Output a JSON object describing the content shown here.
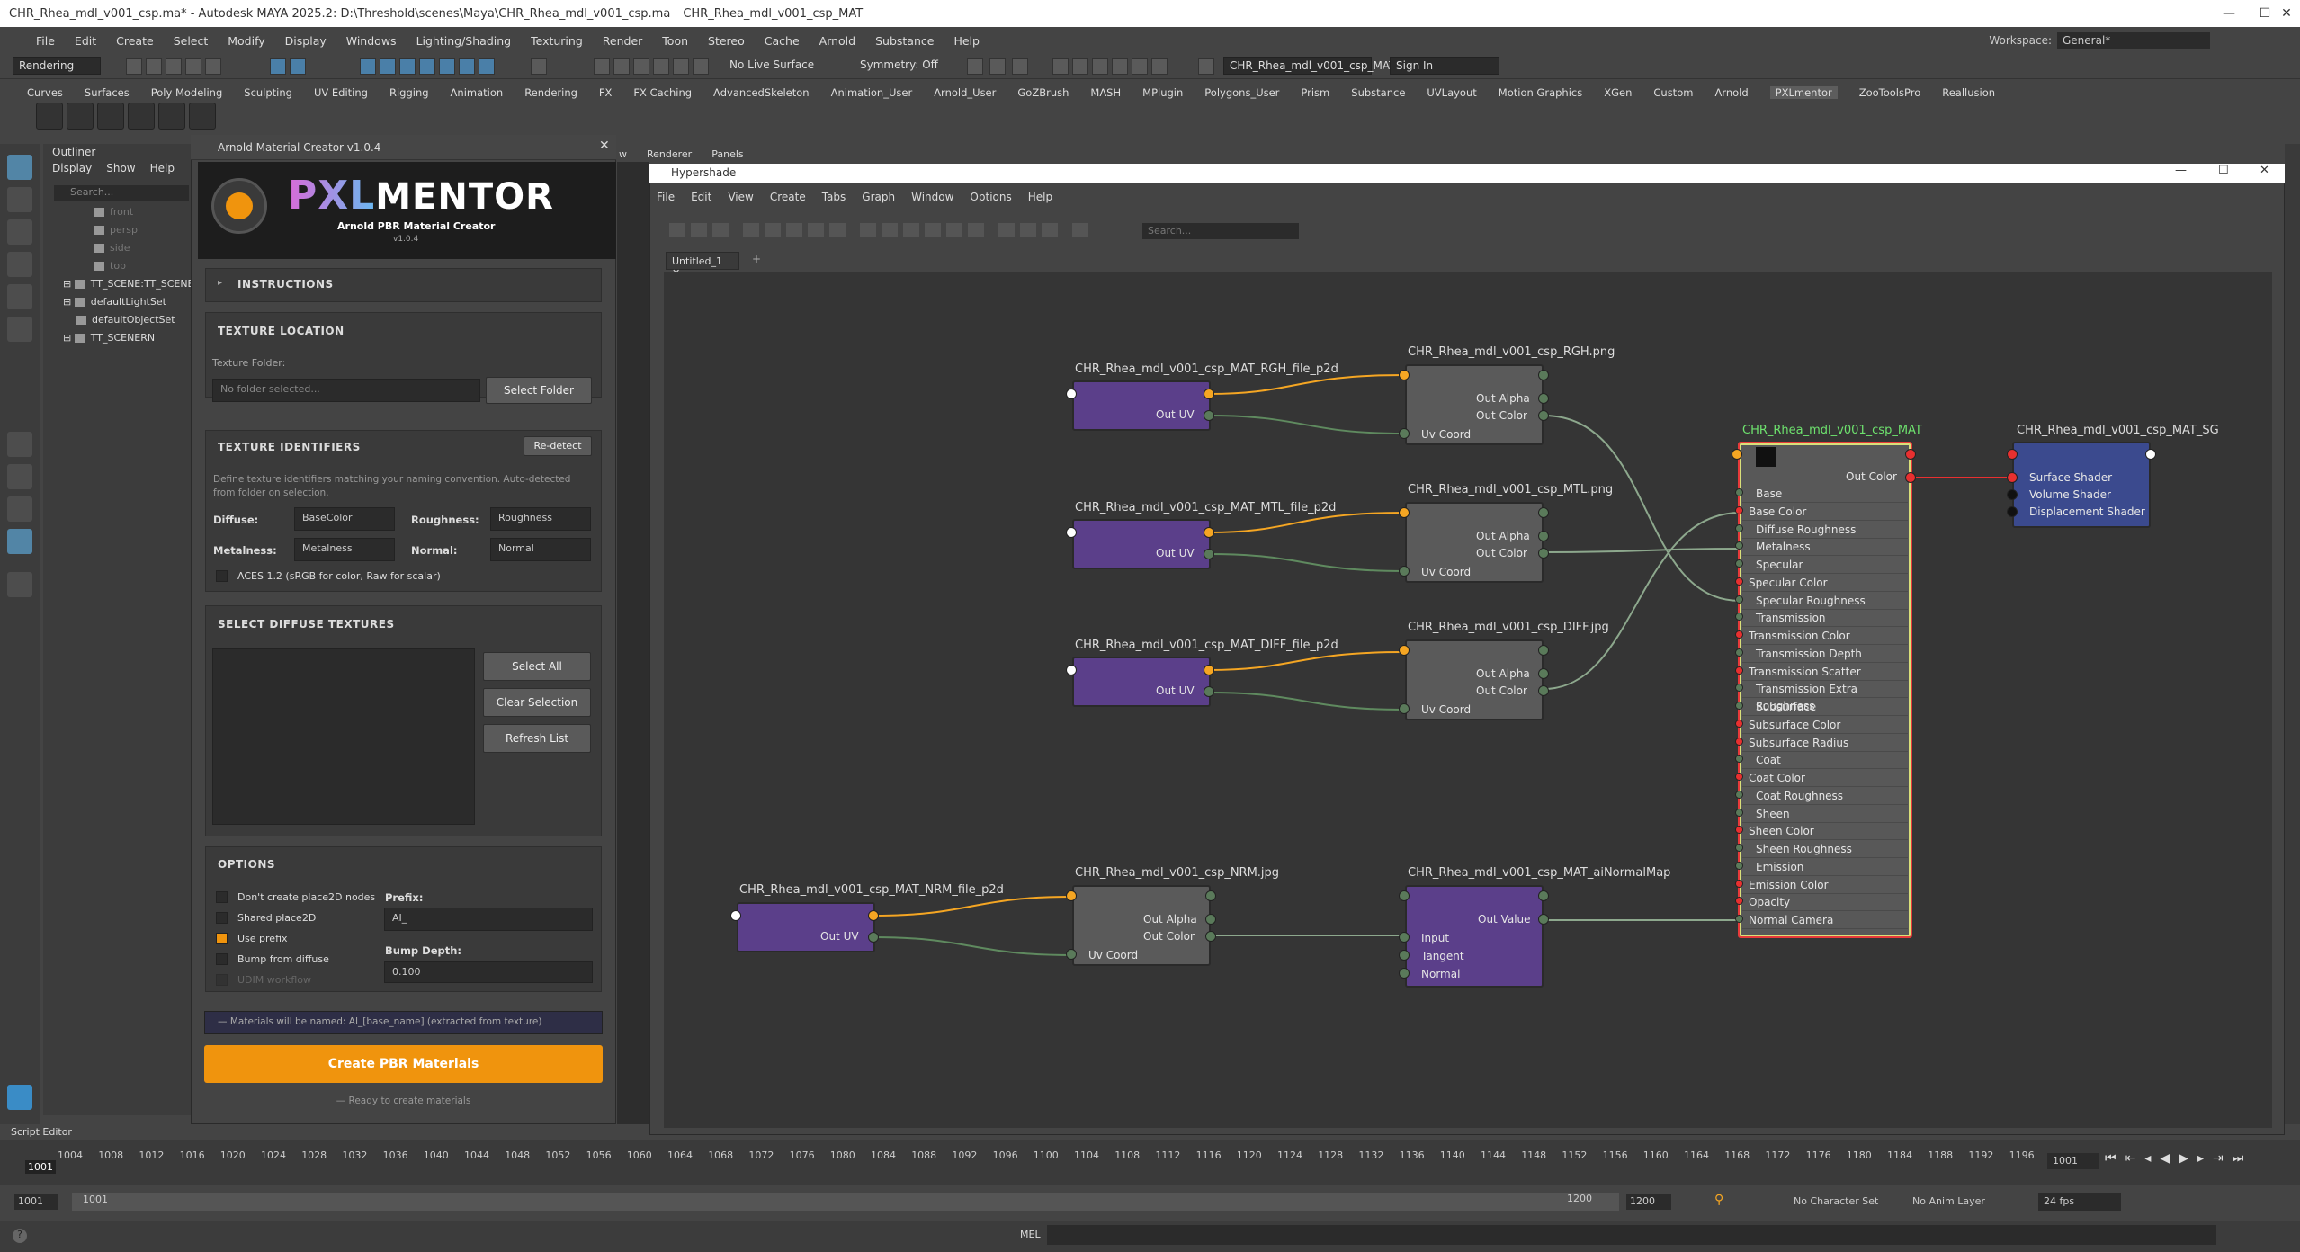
{
  "window": {
    "title": "CHR_Rhea_mdl_v001_csp.ma* - Autodesk MAYA 2025.2: D:\\Threshold\\scenes\\Maya\\CHR_Rhea_mdl_v001_csp.ma",
    "title_extra": "CHR_Rhea_mdl_v001_csp_MAT"
  },
  "menubar": [
    "File",
    "Edit",
    "Create",
    "Select",
    "Modify",
    "Display",
    "Windows",
    "Lighting/Shading",
    "Texturing",
    "Render",
    "Toon",
    "Stereo",
    "Cache",
    "Arnold",
    "Substance",
    "Help"
  ],
  "workspace": {
    "label": "Workspace:",
    "value": "General*"
  },
  "status": {
    "mode": "Rendering",
    "live_surface": "No Live Surface",
    "symmetry": "Symmetry: Off",
    "object_name": "CHR_Rhea_mdl_v001_csp_MAT",
    "sign_in": "Sign In"
  },
  "shelf_tabs": [
    "Curves",
    "Surfaces",
    "Poly Modeling",
    "Sculpting",
    "UV Editing",
    "Rigging",
    "Animation",
    "Rendering",
    "FX",
    "FX Caching",
    "AdvancedSkeleton",
    "Animation_User",
    "Arnold_User",
    "GoZBrush",
    "MASH",
    "MPlugin",
    "Polygons_User",
    "Prism",
    "Substance",
    "UVLayout",
    "Motion Graphics",
    "XGen",
    "Custom",
    "Arnold",
    "PXLmentor",
    "ZooToolsPro",
    "Reallusion"
  ],
  "outliner": {
    "title": "Outliner",
    "menu": [
      "Display",
      "Show",
      "Help"
    ],
    "search": "Search...",
    "cameras": [
      "front",
      "persp",
      "side",
      "top"
    ],
    "items": [
      "TT_SCENE:TT_SCENE_",
      "defaultLightSet",
      "defaultObjectSet",
      "TT_SCENERN"
    ]
  },
  "panel_menu": [
    "w",
    "Renderer",
    "Panels"
  ],
  "amc": {
    "title": "Arnold Material Creator v1.0.4",
    "brand_a": "PXL",
    "brand_b": "MENTOR",
    "subtitle": "Arnold PBR Material Creator",
    "version": "v1.0.4",
    "instructions": "INSTRUCTIONS",
    "texture_location": "TEXTURE LOCATION",
    "texture_folder_label": "Texture Folder:",
    "texture_folder_placeholder": "No folder selected...",
    "select_folder": "Select Folder",
    "identifiers_title": "TEXTURE IDENTIFIERS",
    "redetect": "Re-detect",
    "identifiers_help": "Define texture identifiers matching your naming convention. Auto-detected from folder on selection.",
    "diffuse_label": "Diffuse:",
    "diffuse_value": "BaseColor",
    "roughness_label": "Roughness:",
    "roughness_value": "Roughness",
    "metalness_label": "Metalness:",
    "metalness_value": "Metalness",
    "normal_label": "Normal:",
    "normal_value": "Normal",
    "aces_label": "ACES 1.2 (sRGB for color, Raw for scalar)",
    "diffuse_title": "SELECT DIFFUSE TEXTURES",
    "select_all": "Select All",
    "clear_selection": "Clear Selection",
    "refresh_list": "Refresh List",
    "options_title": "OPTIONS",
    "opt_no_place2d": "Don't create place2D nodes",
    "opt_shared": "Shared place2D",
    "opt_prefix": "Use prefix",
    "opt_bump": "Bump from diffuse",
    "opt_udim": "UDIM workflow",
    "prefix_label": "Prefix:",
    "prefix_value": "AI_",
    "bump_label": "Bump Depth:",
    "bump_value": "0.100",
    "naming_note": "— Materials will be named: AI_[base_name] (extracted from texture)",
    "create_button": "Create PBR Materials",
    "status": "— Ready to create materials"
  },
  "hypershade": {
    "title": "Hypershade",
    "menu": [
      "File",
      "Edit",
      "View",
      "Create",
      "Tabs",
      "Graph",
      "Window",
      "Options",
      "Help"
    ],
    "search": "Search...",
    "tab": "Untitled_1",
    "nodes": {
      "rgh_p2d": "CHR_Rhea_mdl_v001_csp_MAT_RGH_file_p2d",
      "mtl_p2d": "CHR_Rhea_mdl_v001_csp_MAT_MTL_file_p2d",
      "diff_p2d": "CHR_Rhea_mdl_v001_csp_MAT_DIFF_file_p2d",
      "nrm_p2d": "CHR_Rhea_mdl_v001_csp_MAT_NRM_file_p2d",
      "rgh_file": "CHR_Rhea_mdl_v001_csp_RGH.png",
      "mtl_file": "CHR_Rhea_mdl_v001_csp_MTL.png",
      "diff_file": "CHR_Rhea_mdl_v001_csp_DIFF.jpg",
      "nrm_file": "CHR_Rhea_mdl_v001_csp_NRM.jpg",
      "normal_map": "CHR_Rhea_mdl_v001_csp_MAT_aiNormalMap",
      "material": "CHR_Rhea_mdl_v001_csp_MAT",
      "sg": "CHR_Rhea_mdl_v001_csp_MAT_SG"
    },
    "ports": {
      "out_uv": "Out UV",
      "out_alpha": "Out Alpha",
      "out_color": "Out Color",
      "uv_coord": "Uv Coord",
      "out_value": "Out Value",
      "input": "Input",
      "tangent": "Tangent",
      "normal": "Normal",
      "surface_shader": "Surface Shader",
      "volume_shader": "Volume Shader",
      "displacement_shader": "Displacement Shader"
    },
    "material_attrs": [
      "Base",
      "Base Color",
      "Diffuse Roughness",
      "Metalness",
      "Specular",
      "Specular Color",
      "Specular Roughness",
      "Transmission",
      "Transmission Color",
      "Transmission Depth",
      "Transmission Scatter",
      "Transmission Extra Roughness",
      "Subsurface",
      "Subsurface Color",
      "Subsurface Radius",
      "Coat",
      "Coat Color",
      "Coat Roughness",
      "Sheen",
      "Sheen Color",
      "Sheen Roughness",
      "Emission",
      "Emission Color",
      "Opacity",
      "Normal Camera"
    ]
  },
  "timeline": {
    "ticks": [
      "1004",
      "1008",
      "1012",
      "1016",
      "1020",
      "1024",
      "1028",
      "1032",
      "1036",
      "1040",
      "1044",
      "1048",
      "1052",
      "1056",
      "1060",
      "1064",
      "1068",
      "1072",
      "1076",
      "1080",
      "1084",
      "1088",
      "1092",
      "1096",
      "1100",
      "1104",
      "1108",
      "1112",
      "1116",
      "1120",
      "1124",
      "1128",
      "1132",
      "1136",
      "1140",
      "1144",
      "1148",
      "1152",
      "1156",
      "1160",
      "1164",
      "1168",
      "1172",
      "1176",
      "1180",
      "1184",
      "1188",
      "1192",
      "1196"
    ],
    "start_marker": "1001",
    "current": "1001",
    "range_start": "1001",
    "range_start2": "1001",
    "range_end": "1200",
    "range_end2": "1200",
    "char_set": "No Character Set",
    "anim_layer": "No Anim Layer",
    "fps": "24 fps"
  },
  "script_editor": "Script Editor",
  "command_lang": "MEL"
}
